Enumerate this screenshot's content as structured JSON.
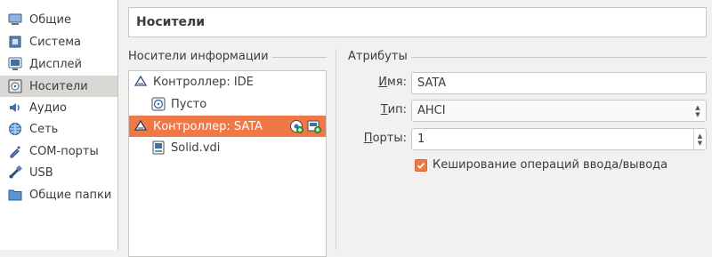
{
  "sidebar": {
    "items": [
      {
        "label": "Общие",
        "icon": "general-icon"
      },
      {
        "label": "Система",
        "icon": "system-icon"
      },
      {
        "label": "Дисплей",
        "icon": "display-icon"
      },
      {
        "label": "Носители",
        "icon": "storage-icon",
        "selected": true
      },
      {
        "label": "Аудио",
        "icon": "audio-icon"
      },
      {
        "label": "Сеть",
        "icon": "network-icon"
      },
      {
        "label": "COM-порты",
        "icon": "serial-ports-icon"
      },
      {
        "label": "USB",
        "icon": "usb-icon"
      },
      {
        "label": "Общие папки",
        "icon": "shared-folders-icon"
      }
    ]
  },
  "header": {
    "title": "Носители"
  },
  "storage": {
    "group_label": "Носители информации",
    "tree": [
      {
        "label": "Контроллер: IDE",
        "type": "controller"
      },
      {
        "label": "Пусто",
        "type": "optical"
      },
      {
        "label": "Контроллер: SATA",
        "type": "controller",
        "selected": true
      },
      {
        "label": "Solid.vdi",
        "type": "hard-disk"
      }
    ]
  },
  "attributes": {
    "group_label": "Атрибуты",
    "name_label_pre": "",
    "name_label_key": "И",
    "name_label_post": "мя:",
    "name_value": "SATA",
    "type_label_pre": "",
    "type_label_key": "Т",
    "type_label_post": "ип:",
    "type_value": "AHCI",
    "ports_label_pre": "",
    "ports_label_key": "П",
    "ports_label_post": "орты:",
    "ports_value": "1",
    "cache_label": "Кеширование операций ввода/вывода",
    "cache_checked": true
  },
  "colors": {
    "accent": "#f07746",
    "selection_bg": "#d9d8d5",
    "window_bg": "#f2f1f0"
  }
}
